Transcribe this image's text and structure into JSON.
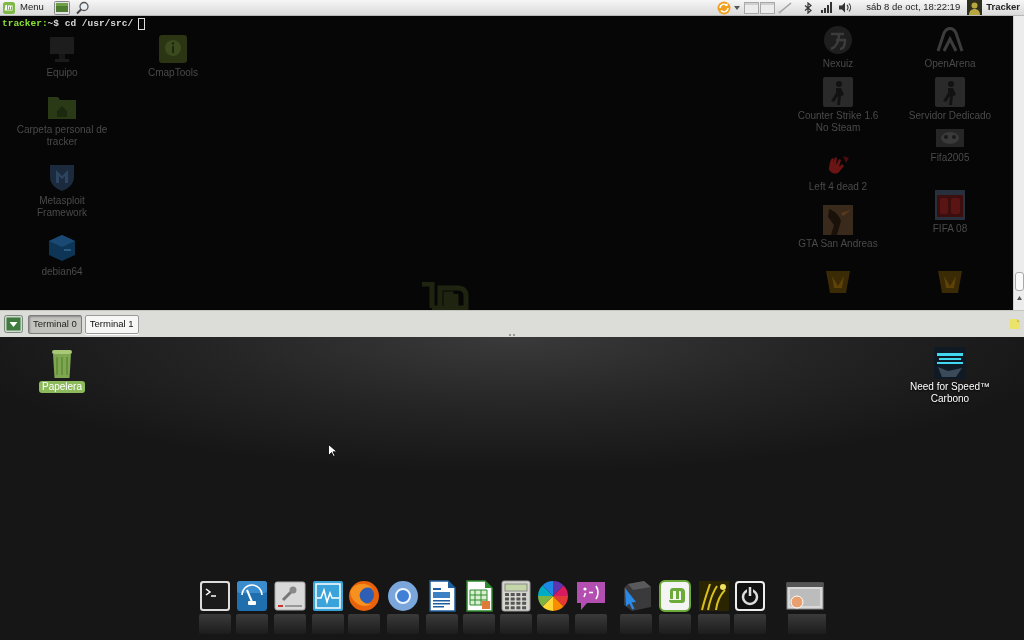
{
  "top_panel": {
    "menu": "Menu",
    "clock": "sáb 8 de oct, 18:22:19",
    "user": "Tracker"
  },
  "terminal": {
    "prompt": "tracker:",
    "command": "~$ cd /usr/src/"
  },
  "backdrop_icons": [
    {
      "label": "Equipo"
    },
    {
      "label": "CmapTools"
    },
    {
      "label": "Carpeta personal de tracker"
    },
    {
      "label": "Metasploit Framework"
    },
    {
      "label": "debian64"
    },
    {
      "label": "Nexuiz"
    },
    {
      "label": "OpenArena"
    },
    {
      "label": "Counter Strike 1.6 No Steam"
    },
    {
      "label": "Servidor Dedicado"
    },
    {
      "label": "Fifa2005"
    },
    {
      "label": "Left 4 dead 2"
    },
    {
      "label": "FIFA 08"
    },
    {
      "label": "GTA San Andreas"
    }
  ],
  "tabs": [
    {
      "label": "Terminal 0",
      "selected": true
    },
    {
      "label": "Terminal 1",
      "selected": false
    }
  ],
  "desktop_icons": [
    {
      "label": "Papelera",
      "selected": true
    },
    {
      "label": "Need for Speed™ Carbono",
      "selected": false
    }
  ]
}
